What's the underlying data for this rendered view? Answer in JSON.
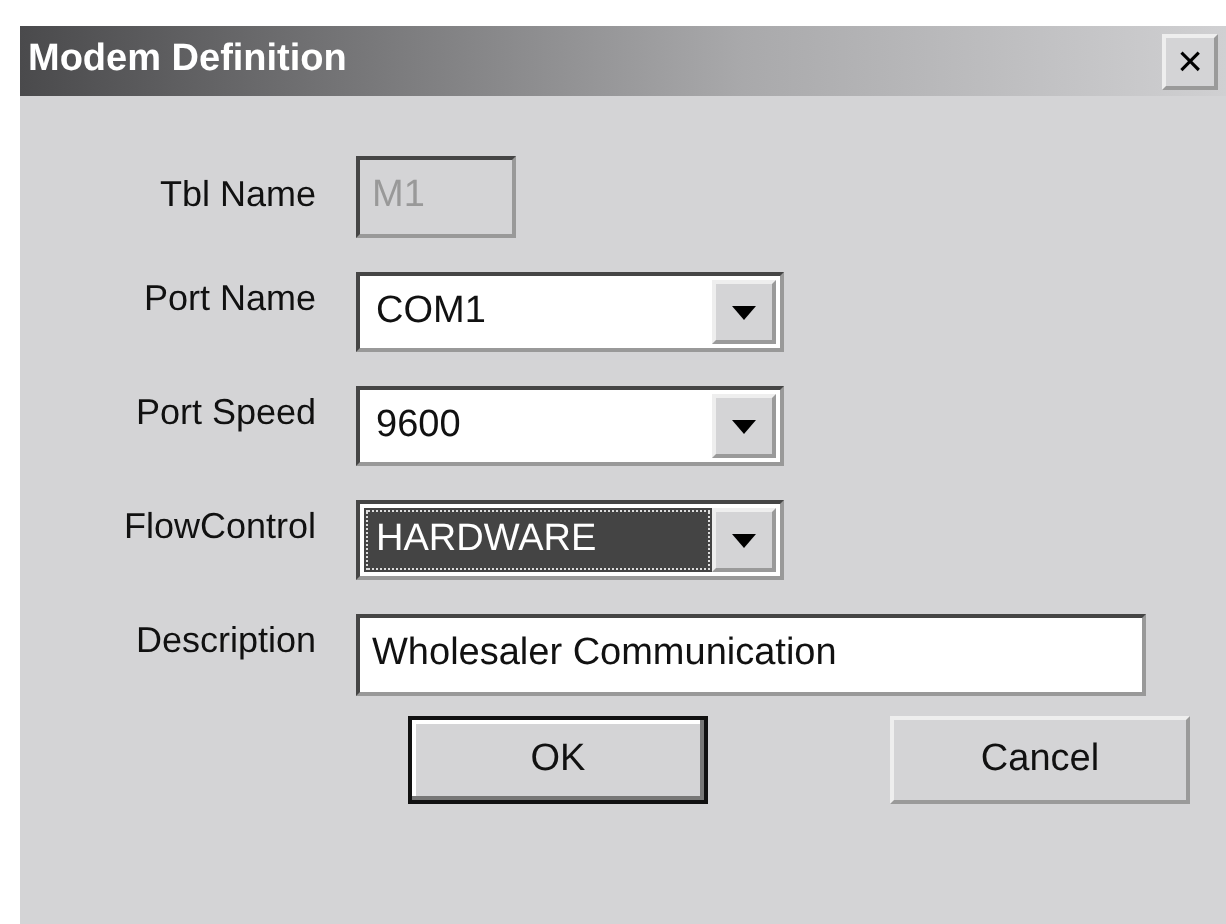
{
  "window": {
    "title": "Modem Definition",
    "close_glyph": "×"
  },
  "fields": [
    {
      "kind": "text",
      "label": "Tbl Name",
      "value": "M1",
      "disabled": true,
      "focused": false
    },
    {
      "kind": "combo",
      "label": "Port Name",
      "value": "COM1",
      "disabled": false,
      "focused": false
    },
    {
      "kind": "combo",
      "label": "Port Speed",
      "value": "9600",
      "disabled": false,
      "focused": false
    },
    {
      "kind": "combo",
      "label": "FlowControl",
      "value": "HARDWARE",
      "disabled": false,
      "focused": true
    },
    {
      "kind": "wide",
      "label": "Description",
      "value": "Wholesaler Communication",
      "disabled": false,
      "focused": false
    }
  ],
  "buttons": [
    {
      "label": "OK",
      "default": true
    },
    {
      "label": "Cancel",
      "default": false
    }
  ]
}
